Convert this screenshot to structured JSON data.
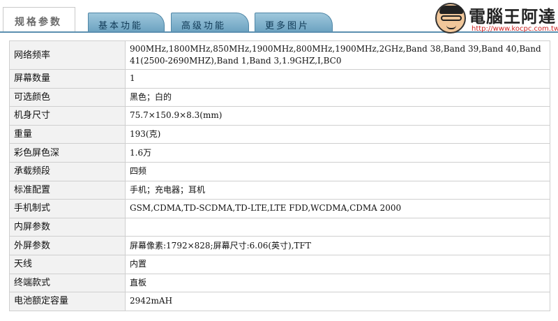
{
  "tabs": {
    "active": "规格参数",
    "items": [
      "基本功能",
      "高级功能",
      "更多图片"
    ]
  },
  "watermark": {
    "title": "電腦王阿達",
    "url": "http://www.kocpc.com.tw"
  },
  "specs": [
    {
      "label": "网络频率",
      "value": "900MHz,1800MHz,850MHz,1900MHz,800MHz,1900MHz,2GHz,Band 38,Band 39,Band 40,Band 41(2500-2690MHZ),Band 1,Band 3,1.9GHZ,I,BC0"
    },
    {
      "label": "屏幕数量",
      "value": "1"
    },
    {
      "label": "可选颜色",
      "value": "黑色；白的"
    },
    {
      "label": "机身尺寸",
      "value": "75.7×150.9×8.3(mm)"
    },
    {
      "label": "重量",
      "value": "193(克)"
    },
    {
      "label": "彩色屏色深",
      "value": "1.6万"
    },
    {
      "label": "承载频段",
      "value": "四频"
    },
    {
      "label": "标准配置",
      "value": "手机；充电器；耳机"
    },
    {
      "label": "手机制式",
      "value": "GSM,CDMA,TD-SCDMA,TD-LTE,LTE FDD,WCDMA,CDMA 2000"
    },
    {
      "label": "内屏参数",
      "value": ""
    },
    {
      "label": "外屏参数",
      "value": "屏幕像素:1792×828;屏幕尺寸:6.06(英寸),TFT"
    },
    {
      "label": "天线",
      "value": "内置"
    },
    {
      "label": "终端款式",
      "value": "直板"
    },
    {
      "label": "电池额定容量",
      "value": "2942mAH"
    }
  ]
}
